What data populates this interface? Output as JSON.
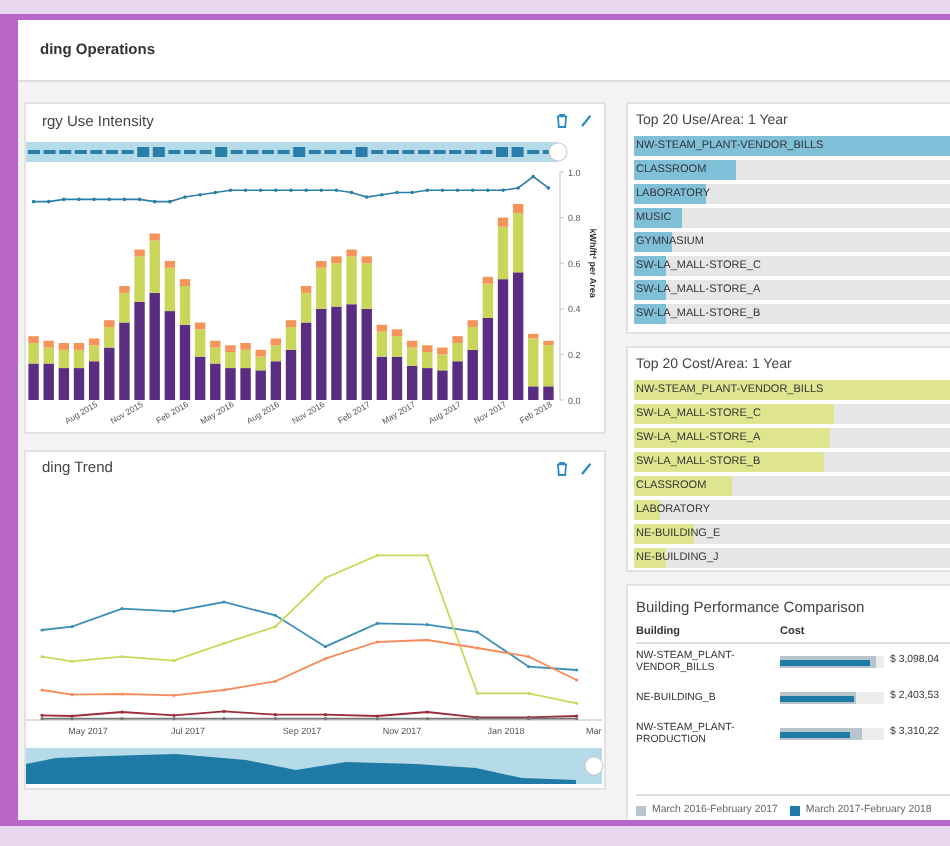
{
  "page": {
    "title": "ding Operations"
  },
  "intensity_card": {
    "title": "rgy Use Intensity",
    "chart_data": {
      "type": "bar",
      "stacked": true,
      "ylabel": "kWh/ft² per Area",
      "ylim": [
        0,
        1
      ],
      "yticks": [
        {
          "value": 0,
          "label": "0.0"
        },
        {
          "value": 0.2,
          "label": "0.2"
        },
        {
          "value": 0.4,
          "label": "0.4"
        },
        {
          "value": 0.6,
          "label": "0.6"
        },
        {
          "value": 0.8,
          "label": "0.8"
        },
        {
          "value": 1,
          "label": "1.0"
        }
      ],
      "categories": [
        null,
        null,
        null,
        null,
        "Aug 2015",
        null,
        null,
        "Nov 2015",
        null,
        null,
        "Feb 2016",
        null,
        null,
        "May 2016",
        null,
        null,
        "Aug 2016",
        null,
        null,
        "Nov 2016",
        null,
        null,
        "Feb 2017",
        null,
        null,
        "May 2017",
        null,
        null,
        "Aug 2017",
        null,
        null,
        "Nov 2017",
        null,
        null,
        "Feb 2018"
      ],
      "series": [
        {
          "color": "#5b2d82",
          "values": [
            0.16,
            0.16,
            0.14,
            0.14,
            0.17,
            0.23,
            0.34,
            0.43,
            0.47,
            0.39,
            0.33,
            0.19,
            0.16,
            0.14,
            0.14,
            0.13,
            0.17,
            0.22,
            0.34,
            0.4,
            0.41,
            0.42,
            0.4,
            0.19,
            0.19,
            0.15,
            0.14,
            0.13,
            0.17,
            0.22,
            0.36,
            0.53,
            0.56,
            0.06,
            0.06
          ]
        },
        {
          "color": "#c9d65a",
          "values": [
            0.09,
            0.07,
            0.08,
            0.08,
            0.07,
            0.09,
            0.13,
            0.2,
            0.23,
            0.19,
            0.17,
            0.12,
            0.07,
            0.07,
            0.08,
            0.06,
            0.07,
            0.1,
            0.13,
            0.18,
            0.19,
            0.21,
            0.2,
            0.11,
            0.09,
            0.08,
            0.07,
            0.07,
            0.08,
            0.1,
            0.15,
            0.23,
            0.26,
            0.21,
            0.18
          ]
        },
        {
          "color": "#f4935a",
          "values": [
            0.03,
            0.03,
            0.03,
            0.03,
            0.03,
            0.03,
            0.03,
            0.03,
            0.03,
            0.03,
            0.03,
            0.03,
            0.03,
            0.03,
            0.03,
            0.03,
            0.03,
            0.03,
            0.03,
            0.03,
            0.03,
            0.03,
            0.03,
            0.03,
            0.03,
            0.03,
            0.03,
            0.03,
            0.03,
            0.03,
            0.03,
            0.04,
            0.04,
            0.02,
            0.02
          ]
        },
        {
          "type": "line",
          "color": "#2a7fa8",
          "values": [
            0.87,
            0.87,
            0.88,
            0.88,
            0.88,
            0.88,
            0.88,
            0.88,
            0.87,
            0.87,
            0.89,
            0.9,
            0.91,
            0.92,
            0.92,
            0.92,
            0.92,
            0.92,
            0.92,
            0.92,
            0.92,
            0.91,
            0.89,
            0.9,
            0.91,
            0.91,
            0.92,
            0.92,
            0.92,
            0.92,
            0.92,
            0.92,
            0.93,
            0.98,
            0.93
          ]
        }
      ]
    }
  },
  "trend_card": {
    "title": "ding Trend",
    "xlabels": [
      "May 2017",
      "Jul 2017",
      "Sep 2017",
      "Nov 2017",
      "Jan 2018",
      "Mar"
    ]
  },
  "use_card": {
    "title": "Top 20 Use/Area: 1 Year",
    "items": [
      {
        "label": "NW-STEAM_PLANT-VENDOR_BILLS",
        "level": 1.0
      },
      {
        "label": "CLASSROOM",
        "level": 0.32
      },
      {
        "label": "LABORATORY",
        "level": 0.23
      },
      {
        "label": "MUSIC",
        "level": 0.15
      },
      {
        "label": "GYMNASIUM",
        "level": 0.12
      },
      {
        "label": "SW-LA_MALL-STORE_C",
        "level": 0.1
      },
      {
        "label": "SW-LA_MALL-STORE_A",
        "level": 0.1
      },
      {
        "label": "SW-LA_MALL-STORE_B",
        "level": 0.1
      }
    ]
  },
  "cost_card": {
    "title": "Top 20 Cost/Area: 1 Year",
    "items": [
      {
        "label": "NW-STEAM_PLANT-VENDOR_BILLS",
        "level": 1.0
      },
      {
        "label": "SW-LA_MALL-STORE_C",
        "level": 0.63
      },
      {
        "label": "SW-LA_MALL-STORE_A",
        "level": 0.62
      },
      {
        "label": "SW-LA_MALL-STORE_B",
        "level": 0.6
      },
      {
        "label": "CLASSROOM",
        "level": 0.31
      },
      {
        "label": "LABORATORY",
        "level": 0.08
      },
      {
        "label": "NE-BUILDING_E",
        "level": 0.19
      },
      {
        "label": "NE-BUILDING_J",
        "level": 0.1
      }
    ]
  },
  "comparison_card": {
    "title": "Building Performance Comparison",
    "columns": [
      "Building",
      "Cost"
    ],
    "rows": [
      {
        "building": "NW-STEAM_PLANT-VENDOR_BILLS",
        "previous": {
          "level": 0.92
        },
        "current": {
          "level": 0.87
        },
        "cost": "$ 3,098,04"
      },
      {
        "building": "NE-BUILDING_B",
        "previous": {
          "level": 0.73
        },
        "current": {
          "level": 0.71
        },
        "cost": "$ 2,403,53"
      },
      {
        "building": "NW-STEAM_PLANT-PRODUCTION",
        "previous": {
          "level": 0.79
        },
        "current": {
          "level": 0.67
        },
        "cost": "$ 3,310,22"
      }
    ],
    "legend": [
      {
        "label": "March 2016-February 2017",
        "color": "#b8c4cc"
      },
      {
        "label": "March 2017-February 2018",
        "color": "#1f7ba6"
      }
    ]
  }
}
